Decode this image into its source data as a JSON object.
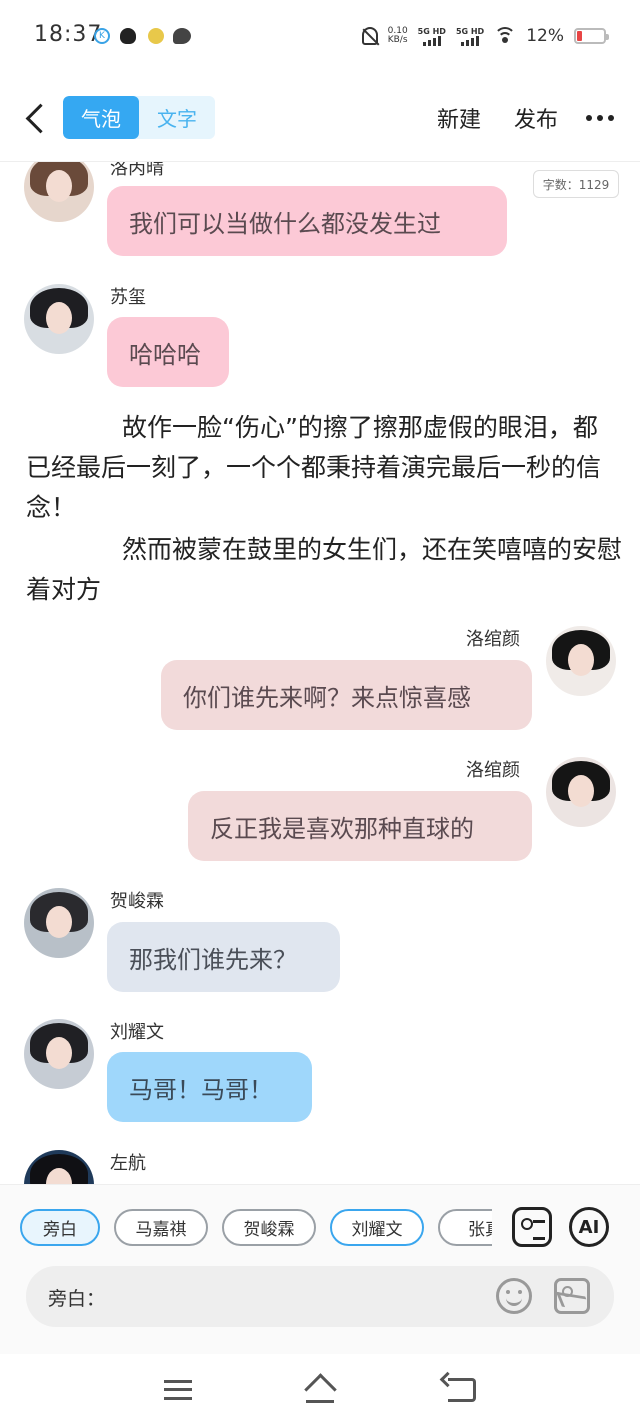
{
  "status_bar": {
    "time": "18:37",
    "net_speed_value": "0.10",
    "net_speed_unit": "KB/s",
    "sim1": "5G HD",
    "sim2": "5G HD",
    "battery": "12%",
    "battery_color": "#e84545"
  },
  "header": {
    "tab_bubble": "气泡",
    "tab_text": "文字",
    "new": "新建",
    "publish": "发布",
    "accent": "#35a8f2"
  },
  "chat": {
    "word_count": "字数：1129",
    "messages": [
      {
        "name": "洛丙晴",
        "text": "我们可以当做什么都没发生过"
      },
      {
        "name": "苏玺",
        "text": "哈哈哈"
      },
      {
        "name": "洛绾颜",
        "text": "你们谁先来啊？来点惊喜感"
      },
      {
        "name": "洛绾颜",
        "text": "反正我是喜欢那种直球的"
      },
      {
        "name": "贺峻霖",
        "text": "那我们谁先来？"
      },
      {
        "name": "刘耀文",
        "text": "马哥！马哥！"
      },
      {
        "name": "左航",
        "text": ""
      }
    ],
    "narration": [
      "故作一脸“伤心”的擦了擦那虚假的眼泪，都已经最后一刻了，一个个都秉持着演完最后一秒的信念！",
      "然而被蒙在鼓里的女生们，还在笑嘻嘻的安慰着对方"
    ]
  },
  "composer": {
    "chips": [
      "旁白",
      "马嘉祺",
      "贺峻霖",
      "刘耀文",
      "张真"
    ],
    "ai_label": "AI",
    "input_value": "旁白："
  }
}
